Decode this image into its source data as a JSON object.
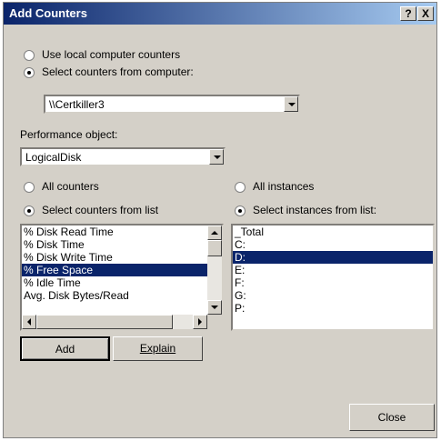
{
  "window": {
    "title": "Add Counters",
    "help_label": "?",
    "close_label": "X"
  },
  "source": {
    "local_label": "Use local computer counters",
    "remote_label": "Select counters from computer:",
    "computer_value": "\\\\Certkiller3"
  },
  "performance_object": {
    "label": "Performance object:",
    "value": "LogicalDisk"
  },
  "counters": {
    "all_label": "All counters",
    "select_label": "Select counters from list",
    "items": [
      "% Disk Read Time",
      "% Disk Time",
      "% Disk Write Time",
      "% Free Space",
      "% Idle Time",
      "Avg. Disk Bytes/Read"
    ],
    "selected_index": 3
  },
  "instances": {
    "all_label": "All instances",
    "select_label": "Select instances from list:",
    "items": [
      "_Total",
      "C:",
      "D:",
      "E:",
      "F:",
      "G:",
      "P:"
    ],
    "selected_index": 2
  },
  "buttons": {
    "add": "Add",
    "explain": "Explain",
    "close": "Close"
  }
}
